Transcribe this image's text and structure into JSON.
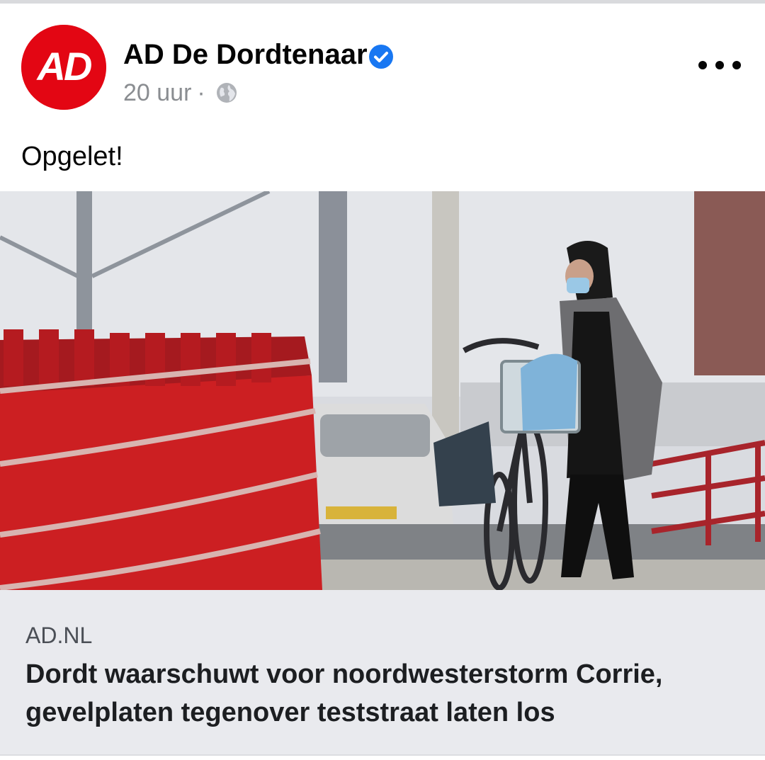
{
  "post": {
    "page_name": "AD De Dordtenaar",
    "avatar_text": "AD",
    "verified_icon": "verified-badge-icon",
    "timestamp": "20 uur",
    "separator": "·",
    "privacy_icon": "globe-icon",
    "more_icon": "more-options-icon",
    "caption": "Opgelet!"
  },
  "link_preview": {
    "domain": "AD.NL",
    "title": "Dordt waarschuwt voor noordwesterstorm Corrie, gevelplaten tegenover teststraat laten los",
    "image_description_icon": "news-photo"
  },
  "colors": {
    "brand_red": "#e30613",
    "verified_blue": "#1877f2",
    "meta_gray": "#8a8d91",
    "card_bg": "#e9eaee"
  }
}
